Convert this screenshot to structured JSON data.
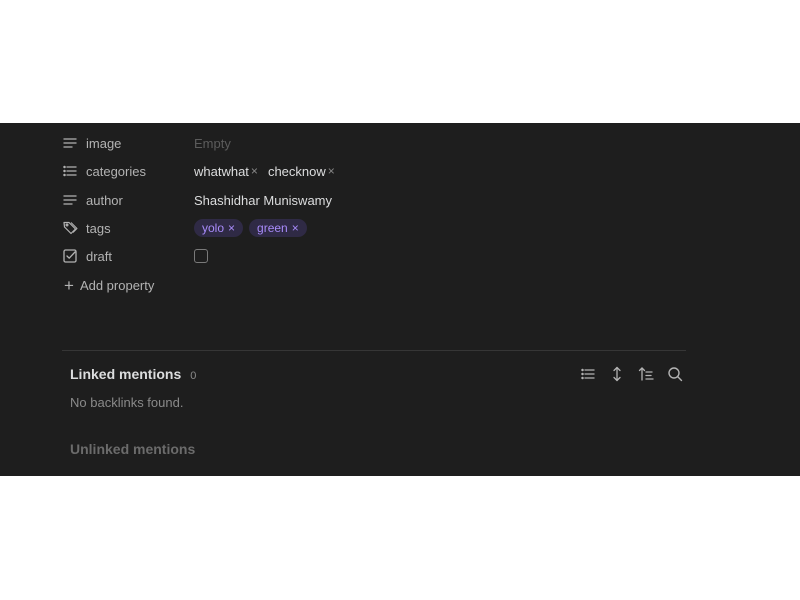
{
  "properties": [
    {
      "key": "image",
      "icon": "text-lines-icon",
      "value": "Empty"
    },
    {
      "key": "categories",
      "icon": "list-icon",
      "chips": [
        "whatwhat",
        "checknow"
      ]
    },
    {
      "key": "author",
      "icon": "text-lines-icon",
      "value": "Shashidhar Muniswamy"
    },
    {
      "key": "tags",
      "icon": "tags-icon",
      "tags": [
        "yolo",
        "green"
      ]
    },
    {
      "key": "draft",
      "icon": "checkbox-icon",
      "checked": false
    }
  ],
  "add_property_label": "Add property",
  "linked_mentions": {
    "title": "Linked mentions",
    "count": "0",
    "empty_text": "No backlinks found."
  },
  "unlinked_mentions": {
    "title": "Unlinked mentions"
  },
  "remove_glyph": "×",
  "toolbar": [
    "list-view-icon",
    "expand-vertical-icon",
    "sort-icon",
    "search-icon"
  ],
  "colors": {
    "background": "#1e1e1e",
    "tag_background": "#2f2a45",
    "tag_text": "#a88bfa"
  }
}
